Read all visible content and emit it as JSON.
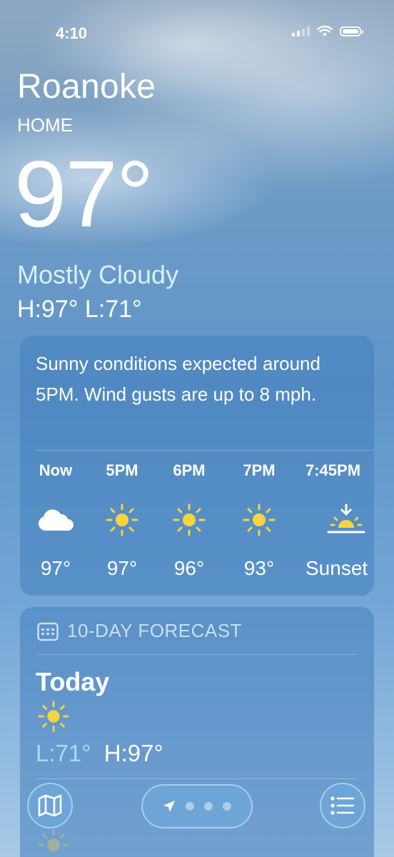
{
  "status_bar": {
    "time": "4:10"
  },
  "location": {
    "city": "Roanoke",
    "label": "HOME"
  },
  "current": {
    "temperature": "97°",
    "condition": "Mostly Cloudy",
    "high_low": "H:97°  L:71°"
  },
  "hourly": {
    "summary": "Sunny conditions expected around 5PM. Wind gusts are up to 8 mph.",
    "hours": [
      {
        "label": "Now",
        "icon": "cloud-icon",
        "temp": "97°"
      },
      {
        "label": "5PM",
        "icon": "sun-icon",
        "temp": "97°"
      },
      {
        "label": "6PM",
        "icon": "sun-icon",
        "temp": "96°"
      },
      {
        "label": "7PM",
        "icon": "sun-icon",
        "temp": "93°"
      },
      {
        "label": "7:45PM",
        "icon": "sunset-icon",
        "temp": "Sunset"
      }
    ]
  },
  "forecast": {
    "title": "10-DAY FORECAST",
    "days": [
      {
        "name": "Today",
        "icon": "sun-icon",
        "low": "L:71°",
        "high": "H:97°"
      }
    ]
  },
  "colors": {
    "sun": "#f8d43c",
    "low_temp": "#a9dcff",
    "condition": "#d8f0ff"
  }
}
